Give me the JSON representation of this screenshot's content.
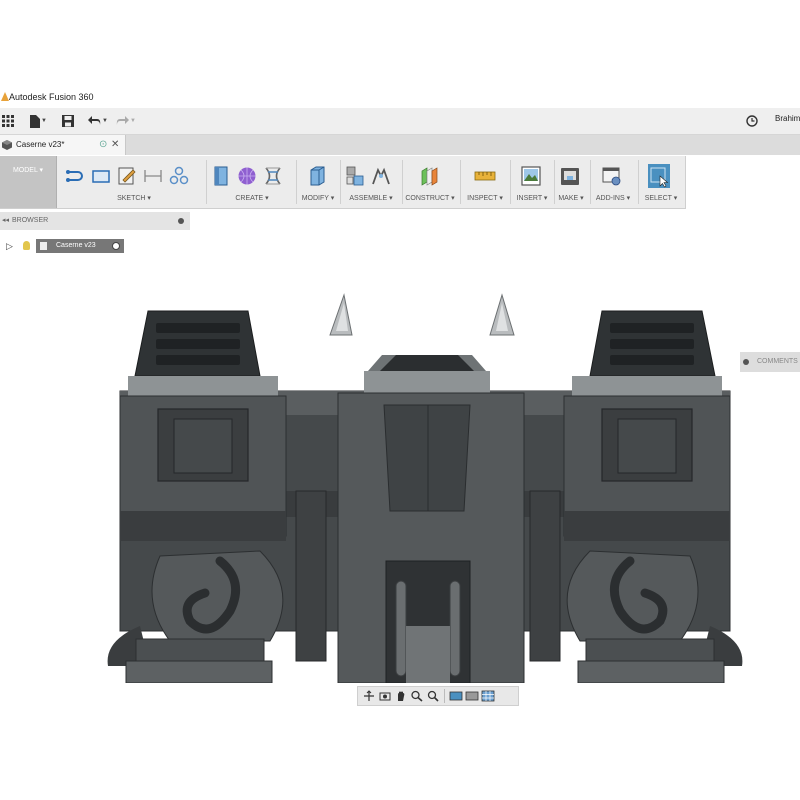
{
  "window": {
    "title": "Autodesk Fusion 360"
  },
  "quick_access": {
    "user": "Brahim"
  },
  "document_tab": {
    "name": "Caserne v23*",
    "sync_glyph": "⊙",
    "close_glyph": "✕"
  },
  "ribbon": {
    "workspace": "MODEL ▾",
    "groups": {
      "sketch": "SKETCH ▾",
      "create": "CREATE ▾",
      "modify": "MODIFY ▾",
      "assemble": "ASSEMBLE ▾",
      "construct": "CONSTRUCT ▾",
      "inspect": "INSPECT ▾",
      "insert": "INSERT ▾",
      "make": "MAKE ▾",
      "addins": "ADD-INS ▾",
      "select": "SELECT ▾"
    }
  },
  "browser": {
    "header": "BROWSER",
    "toggle": "◂◂",
    "root_node": "Caserne v23"
  },
  "comments": {
    "label": "COMMENTS"
  },
  "colors": {
    "ribbon_bg": "#ececec",
    "model_dark": "#3d4143",
    "model_mid": "#55595b",
    "model_light": "#8d9294",
    "select_accent": "#4a90c0"
  }
}
